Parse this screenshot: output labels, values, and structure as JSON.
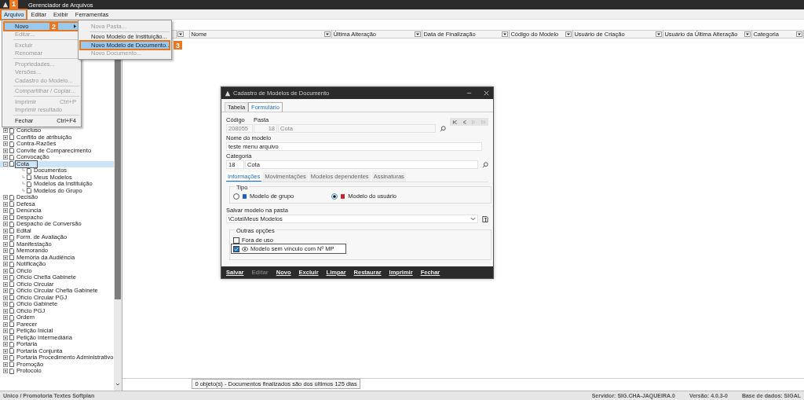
{
  "window": {
    "title": "Gerenciador de Arquivos"
  },
  "menubar": [
    {
      "label": "Arquivo",
      "selected": true,
      "step": "1"
    },
    {
      "label": "Editar",
      "selected": false
    },
    {
      "label": "Exibir",
      "selected": false
    },
    {
      "label": "Ferramentas",
      "selected": false
    }
  ],
  "menu": [
    {
      "kind": "item",
      "label": "Novo",
      "disabled": false,
      "selected": true,
      "submenu": true,
      "step": "2"
    },
    {
      "kind": "item",
      "label": "Editar...",
      "disabled": true,
      "selected": false
    },
    {
      "kind": "separator"
    },
    {
      "kind": "item",
      "label": "Excluir",
      "disabled": true,
      "selected": false
    },
    {
      "kind": "item",
      "label": "Renomear",
      "disabled": true,
      "selected": false
    },
    {
      "kind": "separator"
    },
    {
      "kind": "item",
      "label": "Propriedades...",
      "disabled": true,
      "selected": false
    },
    {
      "kind": "item",
      "label": "Versões...",
      "disabled": true,
      "selected": false
    },
    {
      "kind": "item",
      "label": "Cadastro do Modelo...",
      "disabled": true,
      "selected": false
    },
    {
      "kind": "separator"
    },
    {
      "kind": "item",
      "label": "Compartilhar / Copiar...",
      "disabled": true,
      "selected": false
    },
    {
      "kind": "separator"
    },
    {
      "kind": "item",
      "label": "Imprimir",
      "shortcut": "Ctrl+P",
      "disabled": true,
      "selected": false
    },
    {
      "kind": "item",
      "label": "Imprimir resultado",
      "disabled": true,
      "selected": false
    },
    {
      "kind": "separator"
    },
    {
      "kind": "item",
      "label": "Fechar",
      "shortcut": "Ctrl+F4",
      "disabled": false,
      "selected": false
    }
  ],
  "submenu": [
    {
      "kind": "item",
      "label": "Nova Pasta...",
      "disabled": true,
      "selected": false
    },
    {
      "kind": "separator"
    },
    {
      "kind": "item",
      "label": "Novo Modelo de Instituição...",
      "disabled": false,
      "selected": false
    },
    {
      "kind": "item",
      "label": "Novo Modelo de Documento...",
      "disabled": false,
      "selected": true,
      "step": "3"
    },
    {
      "kind": "item",
      "label": "Novo Documento...",
      "disabled": true,
      "selected": false
    }
  ],
  "tree": [
    {
      "label": "Concluso",
      "expanded": false,
      "selected": false
    },
    {
      "label": "Conflito de atribuição",
      "expanded": false,
      "selected": false
    },
    {
      "label": "Contra-Razões",
      "expanded": false,
      "selected": false
    },
    {
      "label": "Convite de Comparecimento",
      "expanded": false,
      "selected": false
    },
    {
      "label": "Convocação",
      "expanded": false,
      "selected": false
    },
    {
      "label": "Cota",
      "expanded": true,
      "selected": true,
      "children": [
        {
          "label": "Documentos",
          "selected": false
        },
        {
          "label": "Meus Modelos",
          "selected": false
        },
        {
          "label": "Modelos da Instituição",
          "selected": false
        },
        {
          "label": "Modelos do Grupo",
          "selected": false
        }
      ]
    },
    {
      "label": "Decisão",
      "expanded": false,
      "selected": false
    },
    {
      "label": "Defesa",
      "expanded": false,
      "selected": false
    },
    {
      "label": "Denúncia",
      "expanded": false,
      "selected": false
    },
    {
      "label": "Despacho",
      "expanded": false,
      "selected": false
    },
    {
      "label": "Despacho de Conversão",
      "expanded": false,
      "selected": false
    },
    {
      "label": "Edital",
      "expanded": false,
      "selected": false
    },
    {
      "label": "Form. de Avaliação",
      "expanded": false,
      "selected": false
    },
    {
      "label": "Manifestação",
      "expanded": false,
      "selected": false
    },
    {
      "label": "Memorando",
      "expanded": false,
      "selected": false
    },
    {
      "label": "Memória da Audiência",
      "expanded": false,
      "selected": false
    },
    {
      "label": "Notificação",
      "expanded": false,
      "selected": false
    },
    {
      "label": "Ofício",
      "expanded": false,
      "selected": false
    },
    {
      "label": "Ofício Chefia Gabinete",
      "expanded": false,
      "selected": false
    },
    {
      "label": "Ofício Circular",
      "expanded": false,
      "selected": false
    },
    {
      "label": "Ofício Circular Chefia Gabinete",
      "expanded": false,
      "selected": false
    },
    {
      "label": "Ofício Circular PGJ",
      "expanded": false,
      "selected": false
    },
    {
      "label": "Ofício Gabinete",
      "expanded": false,
      "selected": false
    },
    {
      "label": "Ofício PGJ",
      "expanded": false,
      "selected": false
    },
    {
      "label": "Ordem",
      "expanded": false,
      "selected": false
    },
    {
      "label": "Parecer",
      "expanded": false,
      "selected": false
    },
    {
      "label": "Petição Inicial",
      "expanded": false,
      "selected": false
    },
    {
      "label": "Petição Intermediária",
      "expanded": false,
      "selected": false
    },
    {
      "label": "Portaria",
      "expanded": false,
      "selected": false
    },
    {
      "label": "Portaria Conjunta",
      "expanded": false,
      "selected": false
    },
    {
      "label": "Portaria Procedimento Administrativo",
      "expanded": false,
      "selected": false
    },
    {
      "label": "Promoção",
      "expanded": false,
      "selected": false
    },
    {
      "label": "Protocolo",
      "expanded": false,
      "selected": false
    }
  ],
  "table": {
    "columns": [
      "",
      "",
      "Nome",
      "Última Alteração",
      "Data de Finalização",
      "Código do Modelo",
      "Usuário de Criação",
      "Usuário da Última Alteração",
      "Categoria"
    ]
  },
  "status": "0 objeto(s) - Documentos finalizados são dos últimos 125 dias",
  "dialog": {
    "title": "Cadastro de Modelos de Documento",
    "tabs": [
      {
        "label": "Tabela",
        "selected": false
      },
      {
        "label": "Formulário",
        "selected": true
      }
    ],
    "codigo_label": "Código",
    "codigo": "208055",
    "pasta_label": "Pasta",
    "pasta_id": "18",
    "pasta": "Cota",
    "nome_label": "Nome do modelo",
    "nome": "teste menu arquivo",
    "categoria_label": "Categoria",
    "categoria_id": "18",
    "categoria": "Cota",
    "subtabs": [
      {
        "label": "Informações",
        "selected": true
      },
      {
        "label": "Movimentações",
        "selected": false
      },
      {
        "label": "Modelos dependentes",
        "selected": false
      },
      {
        "label": "Assinaturas",
        "selected": false
      }
    ],
    "tipo_label": "Tipo",
    "tipo": [
      {
        "label": "Modelo de grupo",
        "selected": false,
        "color": "#1f5fb8"
      },
      {
        "label": "Modelo do usuário",
        "selected": true,
        "color": "#c8202a"
      }
    ],
    "salvar_label": "Salvar modelo na pasta",
    "salvar": "\\Cota\\Meus Modelos",
    "outras_label": "Outras opções",
    "options": [
      {
        "label": "Fora de uso",
        "checked": false,
        "focused": false
      },
      {
        "label": "Modelo sem vínculo com Nº MP",
        "checked": true,
        "focused": true
      }
    ],
    "buttons": [
      {
        "label": "Salvar",
        "disabled": false
      },
      {
        "label": "Editar",
        "disabled": true
      },
      {
        "label": "Novo",
        "disabled": false
      },
      {
        "label": "Excluir",
        "disabled": false
      },
      {
        "label": "Limpar",
        "disabled": false
      },
      {
        "label": "Restaurar",
        "disabled": false
      },
      {
        "label": "Imprimir",
        "disabled": false
      },
      {
        "label": "Fechar",
        "disabled": false
      }
    ]
  },
  "footer": {
    "left": "Unico / Promotoria Textes Softplan",
    "right": [
      "Servidor: SIG.CHA-JAQUEIRA.0",
      "Versão: 4.0.3-0",
      "Base de dados: SIGAL"
    ]
  }
}
